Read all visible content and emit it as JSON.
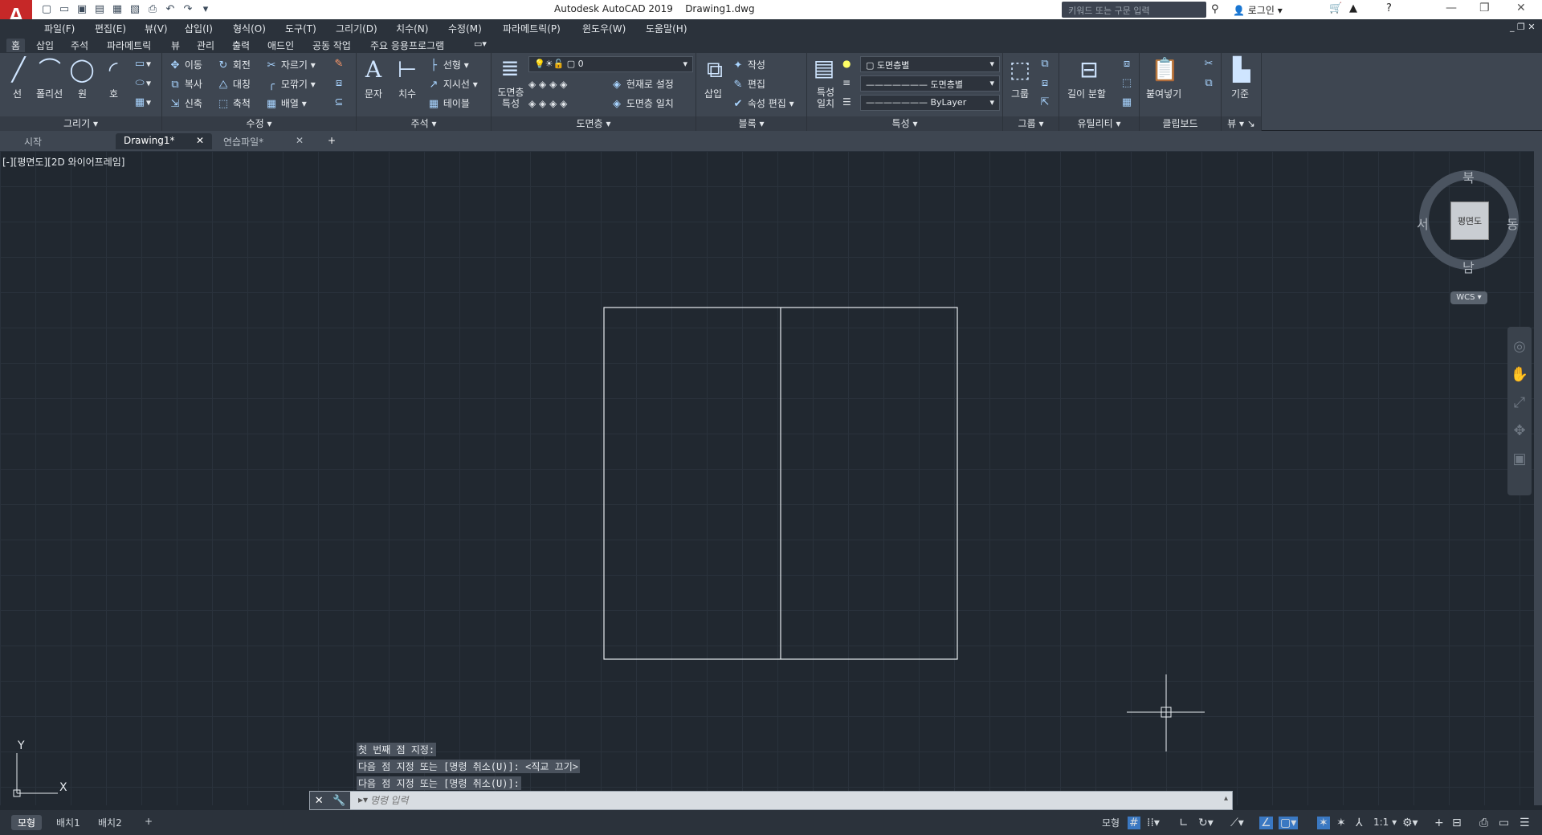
{
  "titlebar": {
    "app_title": "Autodesk AutoCAD 2019",
    "file_name": "Drawing1.dwg",
    "search_placeholder": "키워드 또는 구문 입력",
    "login": "로그인"
  },
  "menu": [
    "파일(F)",
    "편집(E)",
    "뷰(V)",
    "삽입(I)",
    "형식(O)",
    "도구(T)",
    "그리기(D)",
    "치수(N)",
    "수정(M)",
    "파라메트릭(P)",
    "윈도우(W)",
    "도움말(H)"
  ],
  "ribbon_tabs": [
    "홈",
    "삽입",
    "주석",
    "파라메트릭",
    "뷰",
    "관리",
    "출력",
    "애드인",
    "공동 작업",
    "주요 응용프로그램"
  ],
  "panels": {
    "draw": {
      "label": "그리기",
      "tools": [
        "선",
        "폴리선",
        "원",
        "호"
      ]
    },
    "modify": {
      "label": "수정",
      "tools": [
        "이동",
        "회전",
        "자르기",
        "복사",
        "대칭",
        "모깎기",
        "신축",
        "축척",
        "배열"
      ]
    },
    "annotation": {
      "label": "주석",
      "tools": [
        "문자",
        "치수",
        "선형",
        "지시선",
        "테이블"
      ]
    },
    "layers": {
      "label": "도면층",
      "tools": [
        "도면층 특성",
        "현재로 설정",
        "도면층 일치"
      ],
      "current": "0"
    },
    "block": {
      "label": "블록",
      "tools": [
        "삽입",
        "작성",
        "편집",
        "속성 편집"
      ]
    },
    "properties": {
      "label": "특성",
      "tools": [
        "특성 일치"
      ],
      "color": "도면층별",
      "linetype": "도면층별",
      "lineweight": "ByLayer"
    },
    "groups": {
      "label": "그룹",
      "tools": [
        "그룹"
      ]
    },
    "utilities": {
      "label": "유틸리티",
      "tools": [
        "길이 분할"
      ]
    },
    "clipboard": {
      "label": "클립보드",
      "tools": [
        "붙여넣기"
      ]
    },
    "view": {
      "label": "뷰",
      "tools": [
        "기준"
      ]
    }
  },
  "doc_tabs": [
    "시작",
    "Drawing1*",
    "연습파일*"
  ],
  "viewport": {
    "label": "[-][평면도][2D 와이어프레임]"
  },
  "viewcube": {
    "face": "평면도",
    "north": "북",
    "south": "남",
    "east": "동",
    "west": "서",
    "ucs": "WCS"
  },
  "ucs_icon": {
    "x": "X",
    "y": "Y"
  },
  "command": {
    "history": [
      "첫 번째 점 지정:",
      "다음 점 지정 또는 [명령 취소(U)]:  <직교 끄기>",
      "다음 점 지정 또는 [명령 취소(U)]:"
    ],
    "placeholder": "명령 입력"
  },
  "status": {
    "layout_tabs": [
      "모형",
      "배치1",
      "배치2"
    ],
    "model": "모형",
    "scale": "1:1"
  }
}
